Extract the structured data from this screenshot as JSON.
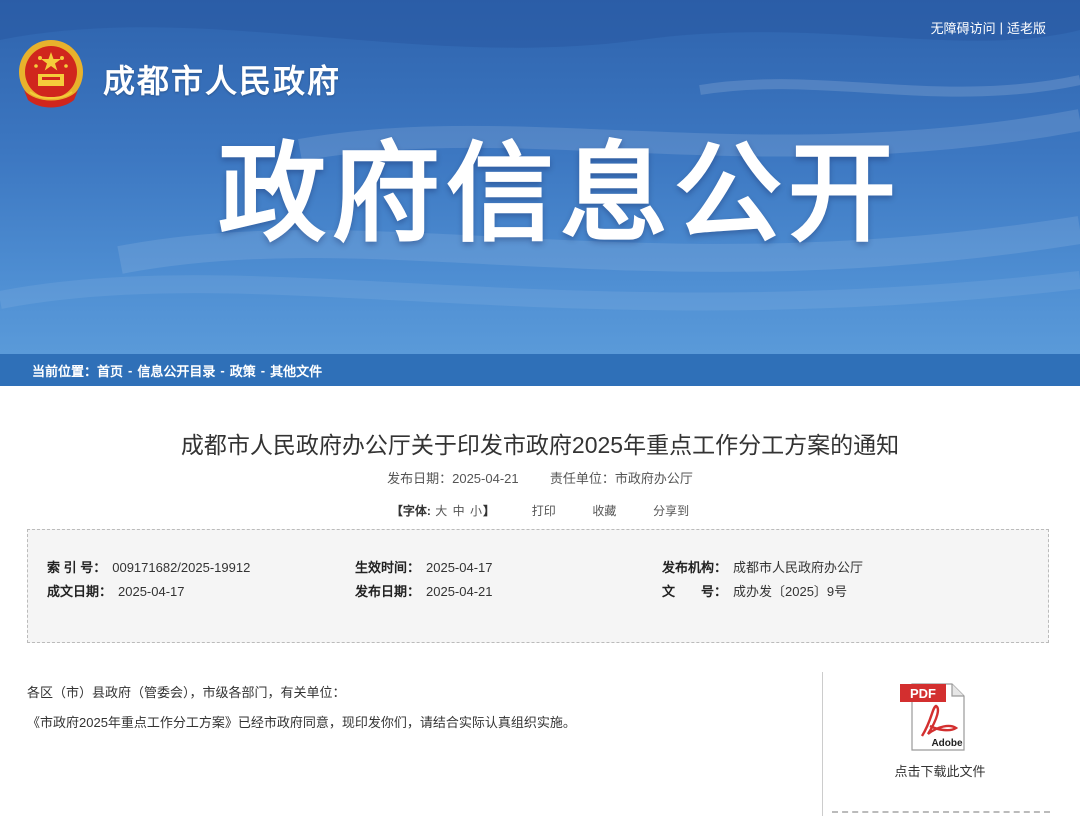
{
  "header": {
    "top_links": [
      "无障碍访问",
      "适老版"
    ],
    "separator": "|",
    "site_name": "成都市人民政府",
    "banner_title": "政府信息公开",
    "emblem_icon": "national-emblem-icon"
  },
  "breadcrumb": {
    "prefix": "当前位置：",
    "items": [
      "首页",
      "信息公开目录",
      "政策",
      "其他文件"
    ],
    "separator": "-"
  },
  "article": {
    "title": "成都市人民政府办公厅关于印发市政府2025年重点工作分工方案的通知",
    "publish_label": "发布日期：",
    "publish_date": "2025-04-21",
    "dept_label": "责任单位：",
    "dept": "市政府办公厅"
  },
  "tools": {
    "open": "【",
    "font_label": "字体:",
    "sizes": [
      "大",
      "中",
      "小"
    ],
    "close": "】",
    "print": "打印",
    "favorite": "收藏",
    "share": "分享到"
  },
  "info": {
    "index_label": "索 引 号：",
    "index_value": "009171682/2025-19912",
    "effective_label": "生效时间：",
    "effective_value": "2025-04-17",
    "issuer_label": "发布机构：",
    "issuer_value": "成都市人民政府办公厅",
    "written_label": "成文日期：",
    "written_value": "2025-04-17",
    "release_label": "发布日期：",
    "release_value": "2025-04-21",
    "docno_label": "文　　号：",
    "docno_value": "成办发〔2025〕9号"
  },
  "body": {
    "paragraphs": [
      "各区（市）县政府（管委会），市级各部门，有关单位：",
      "《市政府2025年重点工作分工方案》已经市政府同意，现印发你们，请结合实际认真组织实施。"
    ]
  },
  "attachment": {
    "icon": "pdf-icon",
    "pdf_text": "PDF",
    "adobe_text": "Adobe",
    "download_label": "点击下载此文件"
  },
  "colors": {
    "banner": "#3d78c2",
    "breadcrumb_bar": "#2f70b8",
    "info_bg": "#f5f5f5",
    "pdf_red": "#d32f2f"
  }
}
